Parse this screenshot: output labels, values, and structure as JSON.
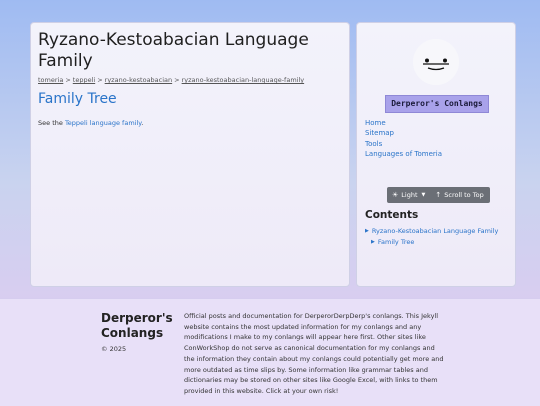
{
  "main": {
    "title": "Ryzano-Kestoabacian Language Family",
    "breadcrumbs": [
      "tomeria",
      "teppeli",
      "ryzano-kestoabacian",
      "ryzano-kestoabacian-language-family"
    ],
    "breadcrumb_separator": ">",
    "section_title": "Family Tree",
    "body_prefix": "See the ",
    "body_link": "Teppeli language family",
    "body_suffix": "."
  },
  "sidebar": {
    "avatar_icon": "face-icon",
    "site_name": "Derperor's Conlangs",
    "nav": [
      "Home",
      "Sitemap",
      "Tools",
      "Languages of Tomeria"
    ],
    "theme_label": "Light",
    "theme_icon": "sun-icon",
    "scroll_label": "Scroll to Top",
    "scroll_icon": "arrow-up-icon",
    "contents_title": "Contents",
    "toc": [
      {
        "label": "Ryzano-Kestoabacian Language Family",
        "level": 1
      },
      {
        "label": "Family Tree",
        "level": 2
      }
    ]
  },
  "footer": {
    "brand": "Derperor's Conlangs",
    "copyright": "© 2025",
    "description": "Official posts and documentation for DerperorDerpDerp's conlangs. This Jekyll website contains the most updated information for my conlangs and any modifications I make to my conlangs will appear here first. Other sites like ConWorkShop do not serve as canonical documentation for my conlangs and the information they contain about my conlangs could potentially get more and more outdated as time slips by. Some information like grammar tables and dictionaries may be stored on other sites like Google Excel, with links to them provided in this website. Click at your own risk!"
  },
  "colors": {
    "link": "#2a74c9",
    "badge": "#a9a2ea",
    "control_bar": "#6b6f76"
  }
}
